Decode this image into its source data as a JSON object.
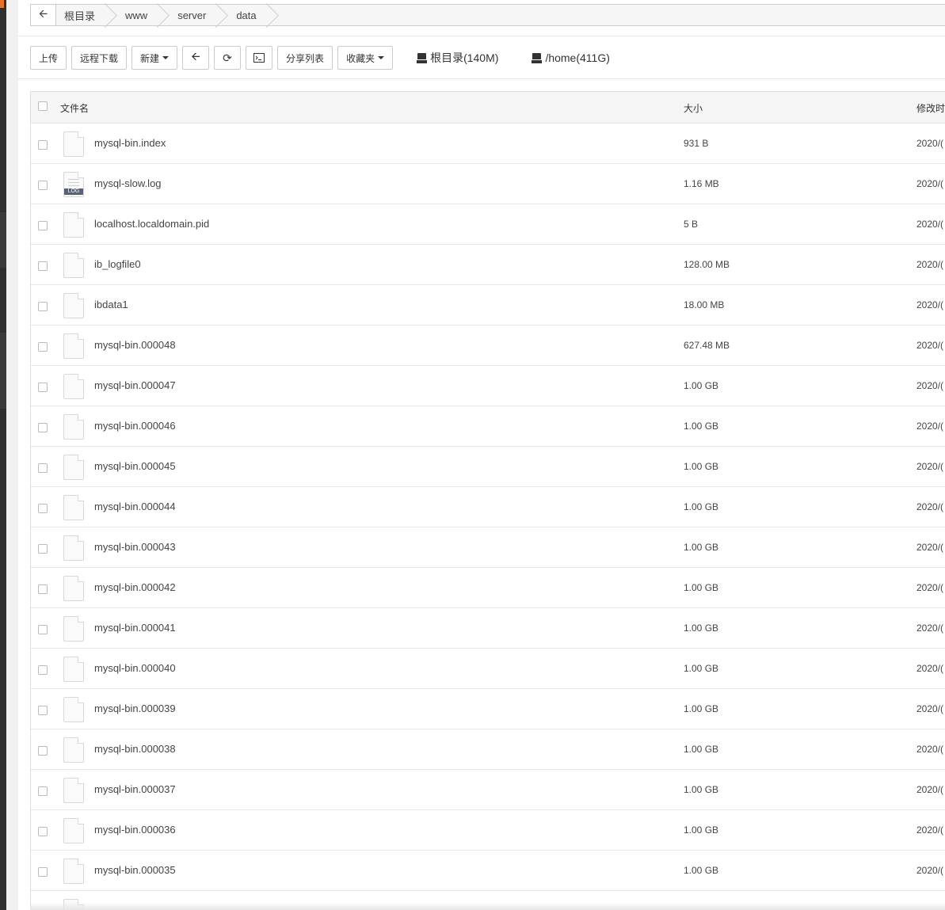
{
  "breadcrumb": {
    "items": [
      "根目录",
      "www",
      "server",
      "data"
    ]
  },
  "toolbar": {
    "upload": "上传",
    "remote_download": "远程下载",
    "new": "新建",
    "share_list": "分享列表",
    "favorites": "收藏夹",
    "disk_root": "根目录(140M)",
    "disk_home": "/home(411G)"
  },
  "table": {
    "headers": {
      "name": "文件名",
      "size": "大小",
      "time": "修改时"
    },
    "rows": [
      {
        "name": "mysql-bin.index",
        "size": "931 B",
        "time": "2020/(",
        "icon": "file-icon"
      },
      {
        "name": "mysql-slow.log",
        "size": "1.16 MB",
        "time": "2020/(",
        "icon": "log-file-icon",
        "badge": "LOG"
      },
      {
        "name": "localhost.localdomain.pid",
        "size": "5 B",
        "time": "2020/(",
        "icon": "file-icon"
      },
      {
        "name": "ib_logfile0",
        "size": "128.00 MB",
        "time": "2020/(",
        "icon": "file-icon"
      },
      {
        "name": "ibdata1",
        "size": "18.00 MB",
        "time": "2020/(",
        "icon": "file-icon"
      },
      {
        "name": "mysql-bin.000048",
        "size": "627.48 MB",
        "time": "2020/(",
        "icon": "file-icon"
      },
      {
        "name": "mysql-bin.000047",
        "size": "1.00 GB",
        "time": "2020/(",
        "icon": "file-icon"
      },
      {
        "name": "mysql-bin.000046",
        "size": "1.00 GB",
        "time": "2020/(",
        "icon": "file-icon"
      },
      {
        "name": "mysql-bin.000045",
        "size": "1.00 GB",
        "time": "2020/(",
        "icon": "file-icon"
      },
      {
        "name": "mysql-bin.000044",
        "size": "1.00 GB",
        "time": "2020/(",
        "icon": "file-icon"
      },
      {
        "name": "mysql-bin.000043",
        "size": "1.00 GB",
        "time": "2020/(",
        "icon": "file-icon"
      },
      {
        "name": "mysql-bin.000042",
        "size": "1.00 GB",
        "time": "2020/(",
        "icon": "file-icon"
      },
      {
        "name": "mysql-bin.000041",
        "size": "1.00 GB",
        "time": "2020/(",
        "icon": "file-icon"
      },
      {
        "name": "mysql-bin.000040",
        "size": "1.00 GB",
        "time": "2020/(",
        "icon": "file-icon"
      },
      {
        "name": "mysql-bin.000039",
        "size": "1.00 GB",
        "time": "2020/(",
        "icon": "file-icon"
      },
      {
        "name": "mysql-bin.000038",
        "size": "1.00 GB",
        "time": "2020/(",
        "icon": "file-icon"
      },
      {
        "name": "mysql-bin.000037",
        "size": "1.00 GB",
        "time": "2020/(",
        "icon": "file-icon"
      },
      {
        "name": "mysql-bin.000036",
        "size": "1.00 GB",
        "time": "2020/(",
        "icon": "file-icon"
      },
      {
        "name": "mysql-bin.000035",
        "size": "1.00 GB",
        "time": "2020/(",
        "icon": "file-icon"
      }
    ]
  }
}
